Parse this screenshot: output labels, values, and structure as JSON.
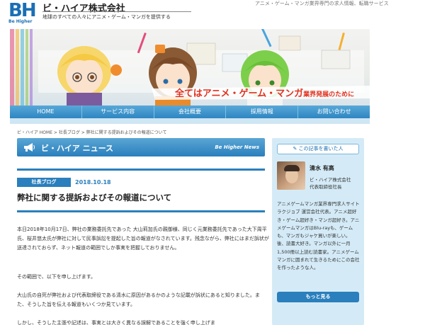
{
  "header": {
    "logo_letters": "BH",
    "logo_sub": "Be Higher",
    "company_name": "ビ・ハイア株式会社",
    "tagline": "地球のすべての人々にアニメ・ゲーム・マンガを提供する",
    "top_right": "アニメ・ゲーム・マンガ業界専門の求人情報、転職サービス"
  },
  "banner": {
    "slogan_big": "全てはアニメ・ゲーム・マンガ",
    "slogan_small": "業界発展のために"
  },
  "nav": {
    "items": [
      "HOME",
      "サービス内容",
      "会社概要",
      "採用情報",
      "お問い合わせ"
    ]
  },
  "breadcrumb": "ビ・ハイア HOME > 社長ブログ > 弊社に関する提訴およびその報道について",
  "news": {
    "title": "ビ・ハイア ニュース",
    "subtitle_en": "Be Higher News"
  },
  "post": {
    "category": "社長ブログ",
    "date": "2018.10.18",
    "title": "弊社に関する提訴およびその報道について",
    "p1": "本日2018年10月17日、弊社の業務委託先であった 大山莉加氏の親御様、同じく元業務委託先であった大下周平氏、桜井悠太氏が弊社に対して民事訴訟を提起した旨の報道がなされています。残念ながら、弊社にはまだ訴状が送達されておらず、ネット報道の範囲でしか事実を把握しておりません。",
    "p2": "その範囲で、以下を申し上げます。",
    "p3": "大山氏の自死が弊社および代表取締役である清水に原因があるかのような記載が訴状にあると知りました。また、そうした旨を伝える報道もいくつか見ています。",
    "p4": "しかし、そうした主張や記述は、事実とは大きく異なる誤解であることを強く申し上げま"
  },
  "sidebar": {
    "author_button": "この記事を書いた人",
    "author_name": "清水 有高",
    "role_line1": "ビ・ハイア株式会社",
    "role_line2": "代表取締役社長",
    "bio": "アニメゲームマンガ業界専門求人サイトラクジョブ 運営会社代表。アニメ超好き・ゲーム超好き・マンガ超好き。アニメゲームマンガはBlu-rayも、ゲームも、マンガもジャケ買いが楽しい。 後、読書大好き。マンガ以外に一月1,500冊以上読む読書家。アニメゲームマンガに囲まれて生きるためにこの会社を作ったような人。",
    "more_button": "もっと見る"
  },
  "colors": {
    "brand_blue": "#2a7fbc",
    "slogan_red": "#e0301e",
    "sidebar_bg": "#d4ebf7"
  }
}
